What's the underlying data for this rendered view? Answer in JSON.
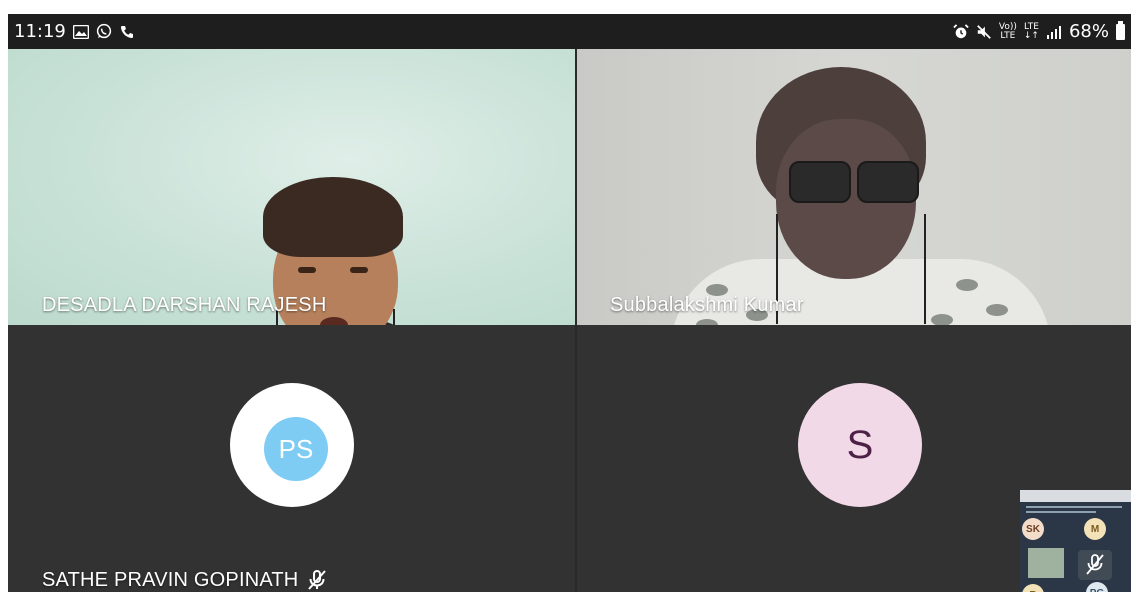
{
  "status_bar": {
    "time": "11:19",
    "notification_icons": [
      "gallery-icon",
      "whatsapp-icon",
      "phone-call-icon"
    ],
    "system_icons": [
      "alarm-icon",
      "mute-icon",
      "volte-icon",
      "lte-icon",
      "signal-icon"
    ],
    "volte_label": "Vo))\nLTE",
    "lte_label": "LTE\n↓↑",
    "battery": "68%"
  },
  "participants": [
    {
      "name": "DESADLA DARSHAN RAJESH",
      "type": "video",
      "muted": false
    },
    {
      "name": "Subbalakshmi Kumar",
      "type": "video",
      "muted": false
    },
    {
      "name": "SATHE PRAVIN GOPINATH",
      "type": "avatar",
      "initials": "PS",
      "muted": true
    },
    {
      "name": "",
      "type": "avatar",
      "initials": "S",
      "muted": false
    }
  ],
  "self_view": {
    "avatars": [
      "SK",
      "M",
      "R",
      "PG"
    ]
  },
  "colors": {
    "tile_bg": "#323233",
    "ps_avatar": "#7ecbf3",
    "s_avatar_bg": "#f1d9e8",
    "s_avatar_text": "#4d2048"
  }
}
